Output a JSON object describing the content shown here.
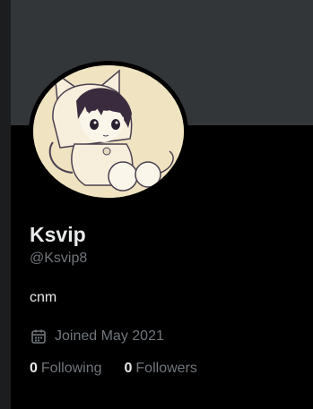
{
  "profile": {
    "display_name": "Ksvip",
    "handle": "@Ksvip8",
    "bio": "cnm",
    "joined": "Joined May 2021",
    "avatar_icon": "anime-cat-hood-avatar",
    "calendar_icon": "calendar-icon"
  },
  "stats": {
    "following_count": "0",
    "following_label": "Following",
    "followers_count": "0",
    "followers_label": "Followers"
  },
  "colors": {
    "background": "#000000",
    "banner": "#333639",
    "primary_text": "#e7e9ea",
    "secondary_text": "#71767b"
  }
}
